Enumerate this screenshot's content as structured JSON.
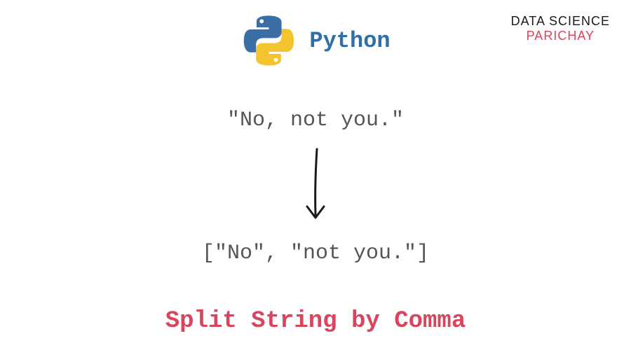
{
  "brand": {
    "line1": "DATA SCIENCE",
    "line2": "PARICHAY"
  },
  "header": {
    "title": "Python"
  },
  "example": {
    "input": "\"No, not you.\"",
    "output": "[\"No\", \"not you.\"]"
  },
  "caption": "Split String by Comma",
  "colors": {
    "accent_blue": "#2f6fa7",
    "accent_red": "#d9455f",
    "logo_blue": "#3776ab",
    "logo_yellow": "#ffd43b",
    "text_gray": "#555555"
  }
}
